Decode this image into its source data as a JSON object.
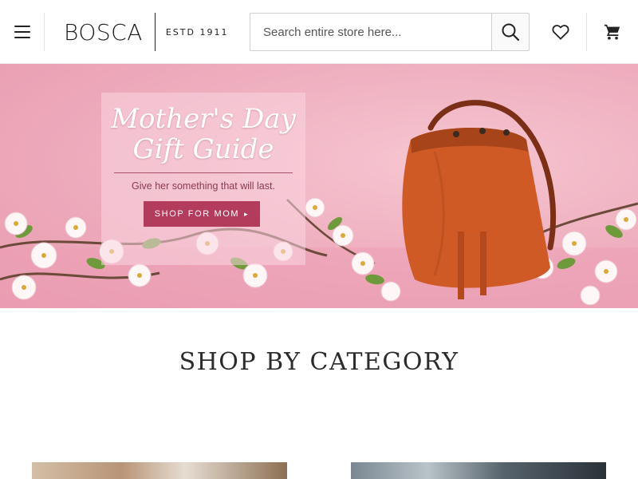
{
  "header": {
    "brand": "BOSCA",
    "established": "ESTD 1911",
    "search": {
      "placeholder": "Search entire store here...",
      "value": ""
    }
  },
  "icons": {
    "menu": "hamburger-menu-icon",
    "search": "search-icon",
    "wishlist": "heart-icon",
    "cart": "shopping-cart-icon"
  },
  "hero": {
    "title_line1": "Mother's Day",
    "title_line2": "Gift Guide",
    "subtitle": "Give her something that will last.",
    "cta_label": "SHOP FOR MOM",
    "cta_arrow": "▸"
  },
  "colors": {
    "hero_background": "#efb0c0",
    "cta_background": "#b33b5b",
    "text_primary": "#2b2b2b"
  },
  "main": {
    "section_title": "SHOP BY CATEGORY"
  }
}
